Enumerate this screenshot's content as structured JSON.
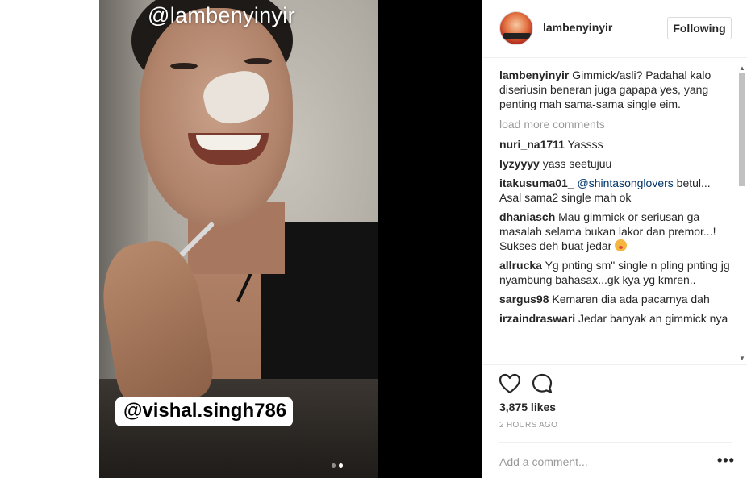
{
  "media": {
    "overlay_handle": "@lambenyinyir",
    "overlay_tag": "@vishal.singh786",
    "carousel": {
      "total": 2,
      "active": 2
    }
  },
  "header": {
    "username": "lambenyinyir",
    "follow_label": "Following",
    "avatar_icon": "profile-avatar"
  },
  "caption": {
    "username": "lambenyinyir",
    "text": "Gimmick/asli? Padahal kalo diseriusin beneran juga gapapa yes, yang penting mah sama-sama single eim."
  },
  "load_more": "load more comments",
  "comments": [
    {
      "user": "nuri_na1711",
      "text": "Yassss"
    },
    {
      "user": "lyzyyyy",
      "text": "yass seetujuu"
    },
    {
      "user": "itakusuma01_",
      "mention": "@shintasonglovers",
      "text": "betul... Asal sama2 single mah ok"
    },
    {
      "user": "dhaniasch",
      "text": "Mau gimmick or seriusan ga masalah selama bukan lakor dan premor...! Sukses deh buat jedar",
      "emoji": "face-blowing-kiss"
    },
    {
      "user": "allrucka",
      "text": "Yg pnting sm\" single n pling pnting jg nyambung bahasax...gk kya yg kmren.."
    },
    {
      "user": "sargus98",
      "text": "Kemaren dia ada pacarnya dah"
    },
    {
      "user": "irzaindraswari",
      "text": "Jedar banyak an gimmick nya"
    }
  ],
  "actions": {
    "like_icon": "heart-icon",
    "comment_icon": "comment-bubble-icon",
    "likes": "3,875 likes",
    "time": "2 HOURS AGO",
    "add_comment_placeholder": "Add a comment...",
    "more_label": "•••"
  },
  "colors": {
    "text": "#262626",
    "muted": "#999999",
    "mention": "#003569",
    "border": "#efefef"
  }
}
